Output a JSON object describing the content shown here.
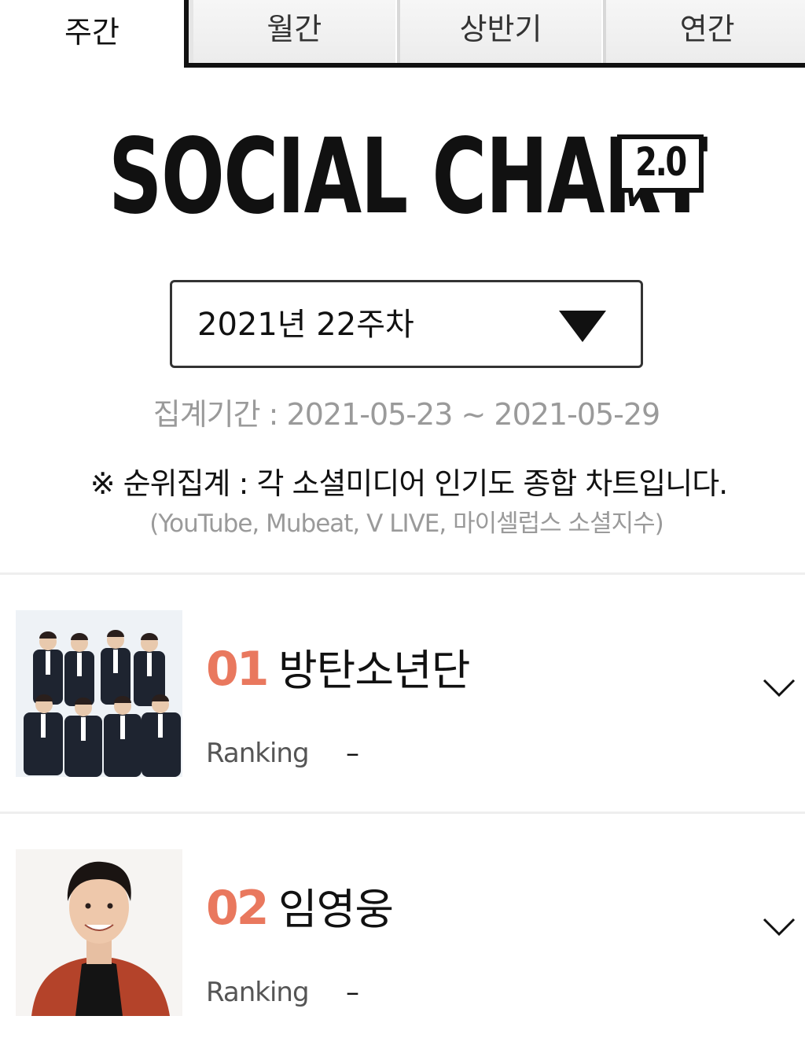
{
  "tabs": {
    "active": "주간",
    "others": [
      "월간",
      "상반기",
      "연간"
    ]
  },
  "logo": {
    "text": "SOCIAL CHART",
    "version": "2.0"
  },
  "week_select": {
    "value": "2021년 22주차"
  },
  "period_text": "집계기간 : 2021-05-23 ~ 2021-05-29",
  "notice": {
    "main": "※ 순위집계 : 각 소셜미디어 인기도 종합 차트입니다.",
    "sources": "(YouTube, Mubeat, V LIVE, 마이셀럽스 소셜지수)"
  },
  "entries": [
    {
      "rank": "01",
      "artist": "방탄소년단",
      "ranking_label": "Ranking",
      "ranking_value": "–"
    },
    {
      "rank": "02",
      "artist": "임영웅",
      "ranking_label": "Ranking",
      "ranking_value": "–"
    }
  ],
  "colors": {
    "rank_accent": "#e9785e",
    "muted_text": "#9a9a9a"
  },
  "icons": {
    "select_arrow": "triangle-down-icon",
    "expand": "chevron-down-icon"
  }
}
